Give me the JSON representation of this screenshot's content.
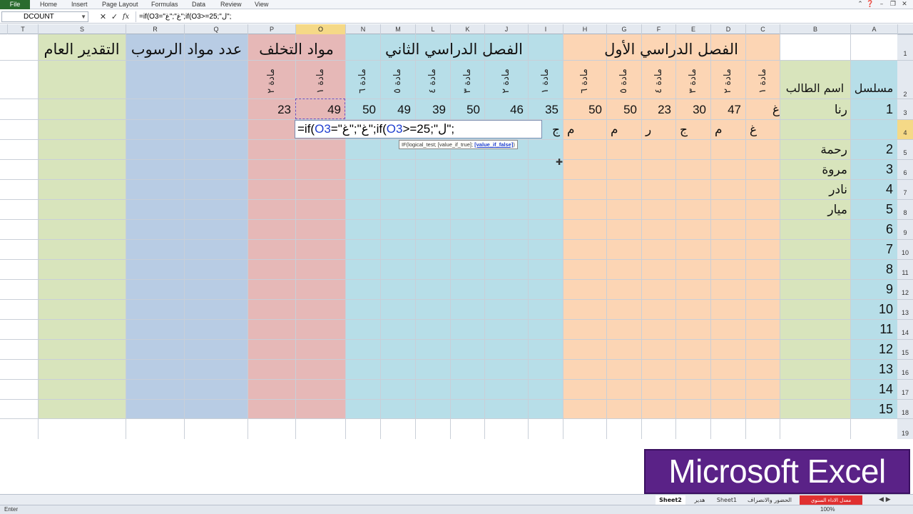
{
  "ribbon": {
    "file": "File",
    "tabs": [
      "Home",
      "Insert",
      "Page Layout",
      "Formulas",
      "Data",
      "Review",
      "View"
    ]
  },
  "formula_bar": {
    "name_box": "DCOUNT",
    "cancel": "✕",
    "enter": "✓",
    "fx": "fx",
    "formula": "=if(O3=\"غ\";\"غ\";if(O3>=25;\"ل\";"
  },
  "columns": [
    "T",
    "S",
    "R",
    "Q",
    "P",
    "O",
    "N",
    "M",
    "L",
    "K",
    "J",
    "I",
    "H",
    "G",
    "F",
    "E",
    "D",
    "C",
    "B",
    "A"
  ],
  "selected_column": "O",
  "rows": [
    "1",
    "2",
    "3",
    "4",
    "5",
    "6",
    "7",
    "8",
    "9",
    "10",
    "11",
    "12",
    "13",
    "14",
    "15",
    "16",
    "17",
    "18",
    "19"
  ],
  "selected_row": "4",
  "headers": {
    "general_grade": "التقدير العام",
    "fail_count": "عدد مواد الرسوب",
    "makeup": "مواد التخلف",
    "term2": "الفصل الدراسي الثاني",
    "term1": "الفصل الدراسي الأول",
    "serial": "مسلسل",
    "student_name": "اسم الطالب"
  },
  "subjects": {
    "makeup": [
      "مادة ٢",
      "مادة ١"
    ],
    "term2": [
      "مادة ٦",
      "مادة ٥",
      "مادة ٤",
      "مادة ٣",
      "مادة ٢",
      "مادة ١"
    ],
    "term1": [
      "مادة ٦",
      "مادة ٥",
      "مادة ٤",
      "مادة ٣",
      "مادة ٢",
      "مادة ١"
    ]
  },
  "row3": {
    "P": "23",
    "O": "49",
    "N": "50",
    "M": "49",
    "L": "39",
    "K": "50",
    "J": "46",
    "I": "35",
    "H": "50",
    "G": "50",
    "F": "23",
    "E": "30",
    "D": "47",
    "C": "غ",
    "B": "رنا",
    "A": "1"
  },
  "row4": {
    "I": "ج",
    "H": "م",
    "G": "م",
    "F": "ر",
    "E": "ج",
    "D": "م",
    "C": "غ"
  },
  "edit_cell": {
    "p1": "=if(",
    "r1": "O3",
    "p2": "=\"غ\";\"غ\";if(",
    "r2": "O3",
    "p3": ">=25;\"ل\";"
  },
  "tooltip": {
    "text": "IF(logical_test; [value_if_true]; ",
    "active": "[value_if_false]",
    "close": ")"
  },
  "students": [
    {
      "serial": "2",
      "name": "رحمة"
    },
    {
      "serial": "3",
      "name": "مروة"
    },
    {
      "serial": "4",
      "name": "نادر"
    },
    {
      "serial": "5",
      "name": "ميار"
    },
    {
      "serial": "6",
      "name": ""
    },
    {
      "serial": "7",
      "name": ""
    },
    {
      "serial": "8",
      "name": ""
    },
    {
      "serial": "9",
      "name": ""
    },
    {
      "serial": "10",
      "name": ""
    },
    {
      "serial": "11",
      "name": ""
    },
    {
      "serial": "12",
      "name": ""
    },
    {
      "serial": "13",
      "name": ""
    },
    {
      "serial": "14",
      "name": ""
    },
    {
      "serial": "15",
      "name": ""
    }
  ],
  "sheet_tabs": [
    "Sheet2",
    "هدير",
    "Sheet1",
    "الحضور والانصراف",
    "معدل الاداء السنوي"
  ],
  "active_sheet": "Sheet2",
  "status": {
    "mode": "Enter",
    "zoom": "100%"
  },
  "brand": "Microsoft Excel",
  "colors": {
    "green_band": "#d8e4bc",
    "blue_band": "#b8cce4",
    "red_band": "#e6b8b7",
    "cyan_band": "#b7dee8",
    "orange_band": "#fcd5b4",
    "serial_band": "#b7dee8",
    "name_band": "#d8e4bc",
    "brand_bg": "#5a2287"
  }
}
